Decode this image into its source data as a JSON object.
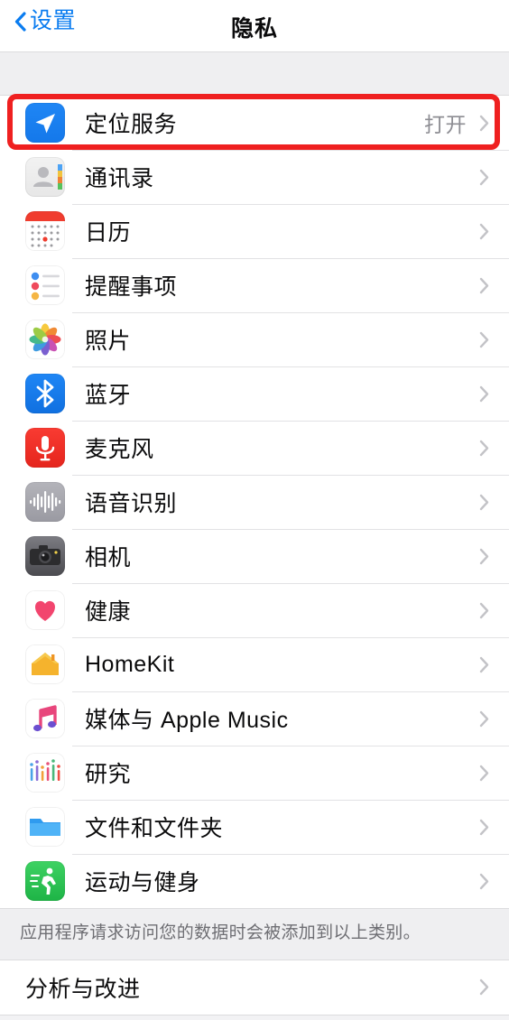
{
  "navbar": {
    "back_label": "设置",
    "back_icon": "chevron-left-icon",
    "title": "隐私"
  },
  "privacy_group": {
    "rows": [
      {
        "icon": "location-services-icon",
        "label": "定位服务",
        "value": "打开",
        "highlighted": true
      },
      {
        "icon": "contacts-icon",
        "label": "通讯录",
        "value": ""
      },
      {
        "icon": "calendar-icon",
        "label": "日历",
        "value": ""
      },
      {
        "icon": "reminders-icon",
        "label": "提醒事项",
        "value": ""
      },
      {
        "icon": "photos-icon",
        "label": "照片",
        "value": ""
      },
      {
        "icon": "bluetooth-icon",
        "label": "蓝牙",
        "value": ""
      },
      {
        "icon": "microphone-icon",
        "label": "麦克风",
        "value": ""
      },
      {
        "icon": "speech-recognition-icon",
        "label": "语音识别",
        "value": ""
      },
      {
        "icon": "camera-icon",
        "label": "相机",
        "value": ""
      },
      {
        "icon": "health-icon",
        "label": "健康",
        "value": ""
      },
      {
        "icon": "homekit-icon",
        "label": "HomeKit",
        "value": ""
      },
      {
        "icon": "music-icon",
        "label": "媒体与 Apple Music",
        "value": ""
      },
      {
        "icon": "research-icon",
        "label": "研究",
        "value": ""
      },
      {
        "icon": "files-icon",
        "label": "文件和文件夹",
        "value": ""
      },
      {
        "icon": "fitness-icon",
        "label": "运动与健身",
        "value": ""
      }
    ]
  },
  "footer_note": "应用程序请求访问您的数据时会被添加到以上类别。",
  "analytics_group": {
    "rows": [
      {
        "label": "分析与改进",
        "value": ""
      }
    ]
  },
  "colors": {
    "accent_blue": "#0a7cf0",
    "highlight_red": "#ef2020",
    "background_gray": "#efeff1",
    "row_white": "#ffffff",
    "value_gray": "#8d8d93",
    "separator": "#e2e2e4"
  }
}
